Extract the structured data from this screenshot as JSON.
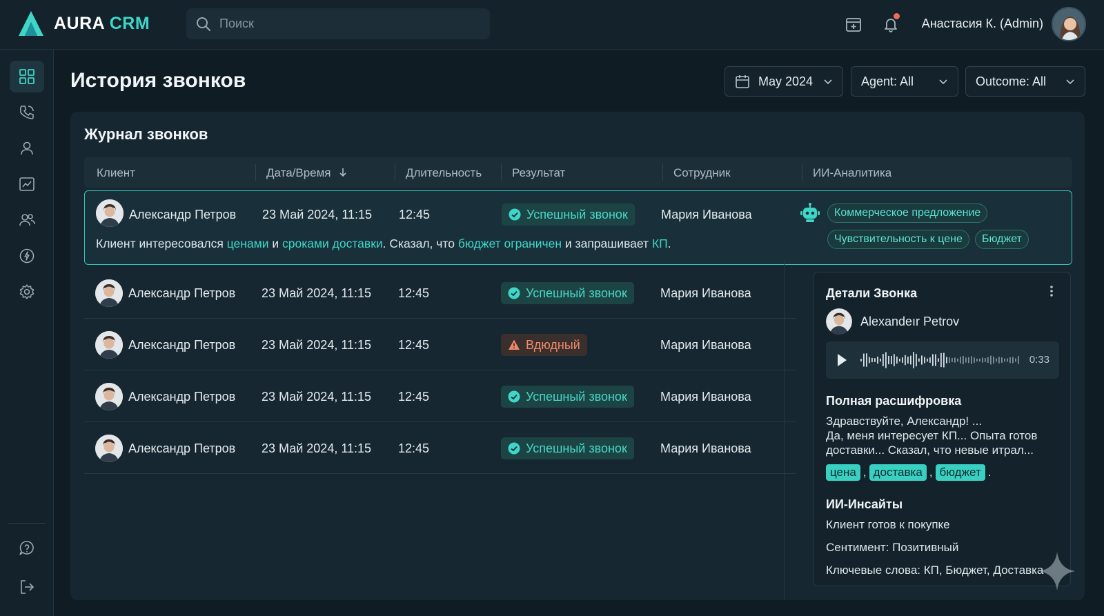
{
  "app": {
    "logo_main": "AURA",
    "logo_accent": "CRM"
  },
  "search": {
    "placeholder": "Поиск"
  },
  "header": {
    "user_name": "Анастасия К. (Admin)"
  },
  "sidebar": {
    "items": [
      {
        "icon": "dashboard-icon",
        "active": true
      },
      {
        "icon": "phone-icon"
      },
      {
        "icon": "user-icon"
      },
      {
        "icon": "analytics-icon"
      },
      {
        "icon": "team-icon"
      },
      {
        "icon": "speed-icon"
      },
      {
        "icon": "gear-icon"
      }
    ],
    "bottom": [
      {
        "icon": "help-icon"
      },
      {
        "icon": "logout-icon"
      }
    ]
  },
  "page": {
    "title": "История звонков"
  },
  "filters": {
    "date": "May 2024",
    "agent": "Agent: All",
    "outcome": "Outcome: All"
  },
  "log": {
    "title": "Журнал звонков",
    "columns": [
      "Клиент",
      "Дата/Время",
      "Длительность",
      "Результат",
      "Сотрудник",
      "ИИ-Аналитика"
    ],
    "rows": [
      {
        "client": "Александр Петров",
        "datetime": "23 Май 2024, 11:15",
        "duration": "12:45",
        "result": "Успешный звонок",
        "result_type": "ok",
        "agent": "Мария Иванова"
      },
      {
        "client": "Александр Петров",
        "datetime": "23 Май 2024, 11:15",
        "duration": "12:45",
        "result": "Успешный звонок",
        "result_type": "ok",
        "agent": "Мария Иванова"
      },
      {
        "client": "Александр Петров",
        "datetime": "23 Май 2024, 11:15",
        "duration": "12:45",
        "result": "Вдюдный",
        "result_type": "warn",
        "agent": "Мария Иванова"
      },
      {
        "client": "Александр Петров",
        "datetime": "23 Май 2024, 11:15",
        "duration": "12:45",
        "result": "Успешный звонок",
        "result_type": "ok",
        "agent": "Мария Иванова"
      },
      {
        "client": "Александр Петров",
        "datetime": "23 Май 2024, 11:15",
        "duration": "12:45",
        "result": "Успешный звонок",
        "result_type": "ok",
        "agent": "Мария Иванова"
      }
    ],
    "summary": {
      "p1": "Клиент интересовался ",
      "h1": "ценами",
      "p2": " и ",
      "h2": "сроками доставки",
      "p3": ". Сказал, что ",
      "h3": "бюджет ограничен",
      "p4": " и запрашивает ",
      "h4": "КП",
      "p5": "."
    },
    "ai_tags": [
      "Коммерческое предложение",
      "Чувствительность к цене",
      "Бюджет"
    ]
  },
  "details": {
    "title": "Детали Звонка",
    "client": "Alexandeır Petrov",
    "audio_time": "0:33",
    "transcript_title": "Полная расшифровка",
    "transcript_lines": [
      "Здравствуйте, Александр! ...",
      "Да, меня интересует КП... Опыта готов",
      "доставки... Сказал, что невые итрал..."
    ],
    "keywords": [
      "цена",
      "доставка",
      "бюджет"
    ],
    "insights_title": "ИИ-Инсайты",
    "insights": [
      "Клиент готов к покупке",
      "Сентимент: Позитивный",
      "Ключевые слова: КП, Бюджет, Доставка"
    ]
  },
  "colors": {
    "accent": "#3fd6c8",
    "background": "#0f1c24",
    "panel": "#162731",
    "warning": "#ee8a6a"
  }
}
